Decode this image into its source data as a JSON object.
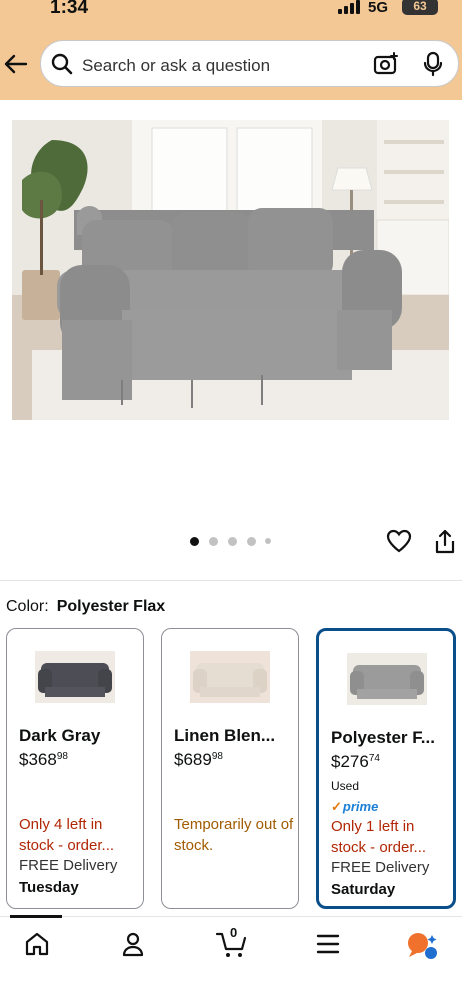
{
  "status_bar": {
    "time": "1:34",
    "network": "5G",
    "battery": "63"
  },
  "search": {
    "placeholder": "Search or ask a question"
  },
  "gallery": {
    "image_count": 5,
    "active_index": 0
  },
  "color": {
    "label": "Color:",
    "selected": "Polyester Flax"
  },
  "variants": [
    {
      "name": "Dark Gray",
      "price_whole": "$368",
      "price_fraction": "98",
      "stock": "Only 4 left in stock - order...",
      "delivery": "FREE Delivery",
      "day": "Tuesday"
    },
    {
      "name": "Linen Blen...",
      "price_whole": "$689",
      "price_fraction": "98",
      "stock": "Temporarily out of stock."
    },
    {
      "name": "Polyester F...",
      "price_whole": "$276",
      "price_fraction": "74",
      "condition": "Used",
      "prime": "prime",
      "stock": "Only 1 left in stock - order...",
      "delivery": "FREE Delivery",
      "day": "Saturday",
      "selected": true
    }
  ],
  "cart": {
    "count": "0"
  },
  "colors": {
    "header": "#f3c895",
    "selected_border": "#0b4f8a",
    "stock_red": "#b12704",
    "stock_orange": "#a15b00",
    "prime_blue": "#1c7fd6"
  }
}
